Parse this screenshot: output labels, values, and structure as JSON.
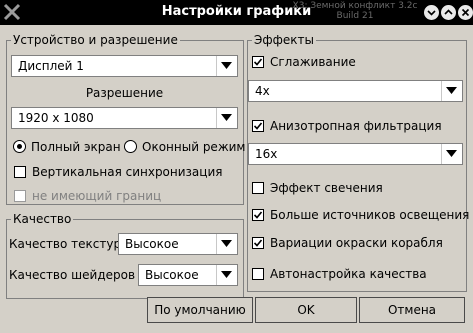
{
  "title": "Настройки графики",
  "app_info": {
    "name": "X3: Земной конфликт 3.2c",
    "build": "Build 21"
  },
  "device": {
    "group_label": "Устройство и разрешение",
    "display_value": "Дисплей 1",
    "resolution_label": "Разрешение",
    "resolution_value": "1920 x 1080",
    "fullscreen_label": "Полный экран",
    "windowed_label": "Оконный режим",
    "mode_selected": "fullscreen",
    "vsync_label": "Вертикальная синхронизация",
    "vsync_checked": false,
    "borderless_label": "не имеющий границ",
    "borderless_checked": false,
    "borderless_enabled": false
  },
  "quality": {
    "group_label": "Качество",
    "texture_label": "Качество текстур",
    "texture_value": "Высокое",
    "shader_label": "Качество шейдеров",
    "shader_value": "Высокое"
  },
  "effects": {
    "group_label": "Эффекты",
    "antialias_label": "Сглаживание",
    "antialias_checked": true,
    "antialias_value": "4x",
    "anisotropic_label": "Анизотропная фильтрация",
    "anisotropic_checked": true,
    "anisotropic_value": "16x",
    "glow_label": "Эффект свечения",
    "glow_checked": false,
    "more_lights_label": "Больше источников освещения",
    "more_lights_checked": true,
    "ship_color_label": "Вариации окраски корабля",
    "ship_color_checked": true,
    "auto_quality_label": "Автонастройка качества",
    "auto_quality_checked": false
  },
  "buttons": {
    "default_label": "По умолчанию",
    "ok_label": "OK",
    "cancel_label": "Отмена"
  },
  "colors": {
    "window_bg": "#d4d0c8",
    "titlebar_bg": "#000000",
    "border": "#808080"
  }
}
